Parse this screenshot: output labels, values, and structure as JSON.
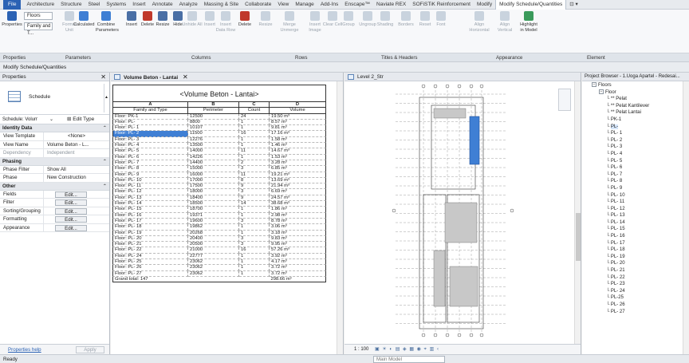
{
  "menu": {
    "tabs": [
      "File",
      "Architecture",
      "Structure",
      "Steel",
      "Systems",
      "Insert",
      "Annotate",
      "Analyze",
      "Massing & Site",
      "Collaborate",
      "View",
      "Manage",
      "Add-Ins",
      "Enscape™",
      "Naviate REX",
      "SOFiSTiK Reinforcement",
      "Modify",
      "Modify Schedule/Quantities"
    ],
    "active": "Modify Schedule/Quantities"
  },
  "ribbon": {
    "type_combo": "Floors",
    "type_combo2": "Family and T...",
    "buttons": [
      {
        "label": "Properties",
        "disabled": false
      },
      {
        "label": "Format Unit",
        "disabled": true
      },
      {
        "label": "Calculated",
        "disabled": false
      },
      {
        "label": "Combine Parameters",
        "disabled": false
      },
      {
        "label": "Insert",
        "disabled": false
      },
      {
        "label": "Delete",
        "disabled": false
      },
      {
        "label": "Resize",
        "disabled": false
      },
      {
        "label": "Hide",
        "disabled": false
      },
      {
        "label": "Unhide All",
        "disabled": true
      },
      {
        "label": "Insert",
        "disabled": true
      },
      {
        "label": "Insert Data Row",
        "disabled": true
      },
      {
        "label": "Delete",
        "disabled": false
      },
      {
        "label": "Resize",
        "disabled": true
      },
      {
        "label": "Merge Unmerge",
        "disabled": true
      },
      {
        "label": "Insert Image",
        "disabled": true
      },
      {
        "label": "Clear Cell",
        "disabled": true
      },
      {
        "label": "Group",
        "disabled": true
      },
      {
        "label": "Ungroup",
        "disabled": true
      },
      {
        "label": "Shading",
        "disabled": true
      },
      {
        "label": "Borders",
        "disabled": true
      },
      {
        "label": "Reset",
        "disabled": true
      },
      {
        "label": "Font",
        "disabled": true
      },
      {
        "label": "Align Horizontal",
        "disabled": true
      },
      {
        "label": "Align Vertical",
        "disabled": true
      },
      {
        "label": "Highlight in Model",
        "disabled": false
      }
    ],
    "panels": [
      "Properties",
      "Parameters",
      "Columns",
      "Rows",
      "Titles & Headers",
      "Appearance",
      "Element"
    ]
  },
  "context_bar": "Modify Schedule/Quantities",
  "properties": {
    "title": "Properties",
    "type_name": "Schedule",
    "instance_selector": "Schedule: Volume Beton",
    "edit_type": "Edit Type",
    "categories": [
      {
        "name": "Identity Data",
        "rows": [
          {
            "key": "View Template",
            "value": "<None>",
            "grey": false,
            "center": true
          },
          {
            "key": "View Name",
            "value": "Volume Beton - L...",
            "grey": false,
            "center": false
          },
          {
            "key": "Dependency",
            "value": "Independent",
            "grey": true,
            "center": false
          }
        ]
      },
      {
        "name": "Phasing",
        "rows": [
          {
            "key": "Phase Filter",
            "value": "Show All",
            "grey": false,
            "center": false
          },
          {
            "key": "Phase",
            "value": "New Construction",
            "grey": false,
            "center": false
          }
        ]
      },
      {
        "name": "Other",
        "rows": [
          {
            "key": "Fields",
            "value": "Edit...",
            "button": true
          },
          {
            "key": "Filter",
            "value": "Edit...",
            "button": true
          },
          {
            "key": "Sorting/Grouping",
            "value": "Edit...",
            "button": true
          },
          {
            "key": "Formatting",
            "value": "Edit...",
            "button": true
          },
          {
            "key": "Appearance",
            "value": "Edit...",
            "button": true
          }
        ]
      }
    ],
    "help_link": "Properties help",
    "apply": "Apply"
  },
  "schedule": {
    "tab_title": "Volume Beton - Lantai",
    "title": "<Volume Beton - Lantai>",
    "letters": [
      "A",
      "B",
      "C",
      "D"
    ],
    "headers": [
      "Family and Type",
      "Perimeter",
      "Count",
      "Volume"
    ],
    "selected_row": 3,
    "rows": [
      [
        "Floor: PK-1",
        "12500",
        "24",
        "19.50 m³"
      ],
      [
        "Floor: PL-",
        "8800",
        "1",
        "8.57 m³"
      ],
      [
        "Floor: PL- 1",
        "10107",
        "1",
        "9.81 m³"
      ],
      [
        "Floor: PL- 2",
        "11500",
        "16",
        "17.16 m³"
      ],
      [
        "Floor: PL- 3",
        "12276",
        "1",
        "1.58 m³"
      ],
      [
        "Floor: PL- 4",
        "13500",
        "1",
        "1.46 m³"
      ],
      [
        "Floor: PL- 5",
        "14000",
        "11",
        "14.67 m³"
      ],
      [
        "Floor: PL- 6",
        "14226",
        "1",
        "1.53 m³"
      ],
      [
        "Floor: PL- 7",
        "14400",
        "2",
        "3.28 m³"
      ],
      [
        "Floor: PL- 8",
        "15000",
        "3",
        "6.85 m³"
      ],
      [
        "Floor: PL- 9",
        "16000",
        "11",
        "19.21 m³"
      ],
      [
        "Floor: PL- 10",
        "17000",
        "8",
        "13.69 m³"
      ],
      [
        "Floor: PL- 11",
        "17500",
        "9",
        "21.94 m³"
      ],
      [
        "Floor: PL- 12",
        "18000",
        "3",
        "6.69 m³"
      ],
      [
        "Floor: PL- 13",
        "18400",
        "9",
        "24.57 m³"
      ],
      [
        "Floor: PL- 14",
        "18500",
        "14",
        "38.68 m³"
      ],
      [
        "Floor: PL- 15",
        "18700",
        "1",
        "1.86 m³"
      ],
      [
        "Floor: PL- 16",
        "19371",
        "1",
        "2.98 m³"
      ],
      [
        "Floor: PL- 17",
        "19600",
        "3",
        "8.78 m³"
      ],
      [
        "Floor: PL- 18",
        "19862",
        "1",
        "3.06 m³"
      ],
      [
        "Floor: PL- 19",
        "20268",
        "1",
        "3.18 m³"
      ],
      [
        "Floor: PL- 20",
        "20400",
        "3",
        "9.83 m³"
      ],
      [
        "Floor: PL- 21",
        "20500",
        "3",
        "9.95 m³"
      ],
      [
        "Floor: PL- 22",
        "21000",
        "16",
        "57.26 m³"
      ],
      [
        "Floor: PL- 24",
        "22777",
        "1",
        "3.92 m³"
      ],
      [
        "Floor: PL- 25",
        "23062",
        "1",
        "4.17 m³"
      ],
      [
        "Floor: PL- 26",
        "23062",
        "1",
        "3.72 m³"
      ],
      [
        "Floor: PL- 27",
        "23062",
        "1",
        "3.72 m³"
      ]
    ],
    "total_label": "Grand total: 147",
    "total_volume": "298.66 m³"
  },
  "plan": {
    "tab_title": "Level 2_Str",
    "scale": "1 : 100"
  },
  "browser": {
    "title": "Project Browser - 1.Uoga Apartel - Redesai...",
    "nodes": [
      {
        "label": "Floors",
        "level": 0,
        "exp": "−"
      },
      {
        "label": "Floor",
        "level": 1,
        "exp": "−"
      },
      {
        "label": "** Pelat",
        "level": 2
      },
      {
        "label": "** Pelat Kantilever",
        "level": 2
      },
      {
        "label": "** Pelat Lantai",
        "level": 2
      },
      {
        "label": "PK-1",
        "level": 2
      },
      {
        "label": "PL-",
        "level": 2,
        "sel": true
      },
      {
        "label": "PL- 1",
        "level": 2
      },
      {
        "label": "PL- 2",
        "level": 2
      },
      {
        "label": "PL- 3",
        "level": 2
      },
      {
        "label": "PL- 4",
        "level": 2
      },
      {
        "label": "PL- 5",
        "level": 2
      },
      {
        "label": "PL- 6",
        "level": 2
      },
      {
        "label": "PL- 7",
        "level": 2
      },
      {
        "label": "PL- 8",
        "level": 2
      },
      {
        "label": "PL- 9",
        "level": 2
      },
      {
        "label": "PL- 10",
        "level": 2
      },
      {
        "label": "PL- 11",
        "level": 2
      },
      {
        "label": "PL- 12",
        "level": 2
      },
      {
        "label": "PL- 13",
        "level": 2
      },
      {
        "label": "PL- 14",
        "level": 2
      },
      {
        "label": "PL- 15",
        "level": 2
      },
      {
        "label": "PL- 16",
        "level": 2
      },
      {
        "label": "PL- 17",
        "level": 2
      },
      {
        "label": "PL- 18",
        "level": 2
      },
      {
        "label": "PL- 19",
        "level": 2
      },
      {
        "label": "PL- 20",
        "level": 2
      },
      {
        "label": "PL- 21",
        "level": 2
      },
      {
        "label": "PL- 22",
        "level": 2
      },
      {
        "label": "PL- 23",
        "level": 2
      },
      {
        "label": "PL- 24",
        "level": 2
      },
      {
        "label": "PL-25",
        "level": 2
      },
      {
        "label": "PL- 26",
        "level": 2
      },
      {
        "label": "PL- 27",
        "level": 2
      }
    ]
  },
  "status": {
    "ready": "Ready",
    "model": "Main Model"
  },
  "colors": {
    "accent": "#2b62b4",
    "selection": "#3f7fd4"
  }
}
